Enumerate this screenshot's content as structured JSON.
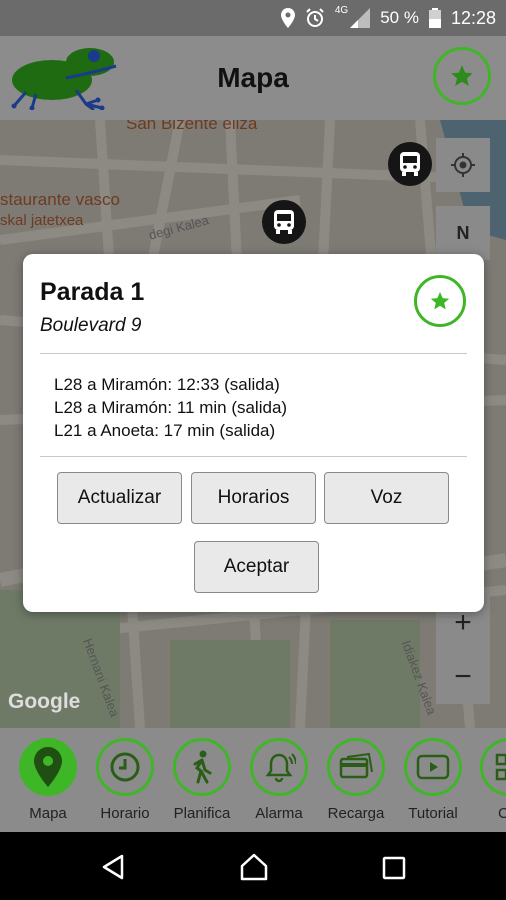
{
  "status_bar": {
    "network": "4G",
    "battery": "50 %",
    "time": "12:28",
    "icons": [
      "location-icon",
      "alarm-clock-icon",
      "signal-icon",
      "battery-icon"
    ]
  },
  "header": {
    "title": "Mapa",
    "logo_icon": "frog-logo-icon",
    "favorite_icon": "star-icon"
  },
  "map": {
    "labels": {
      "church": "San Bizente eliza",
      "restaurant_line1": "staurante vasco",
      "restaurant_line2": "skal jatetxea",
      "street_a": "degi Kalea",
      "street_b": "Hernani Kalea",
      "street_c": "Idiakez Kalea"
    },
    "google": "Google",
    "controls": {
      "compass": "N",
      "zoom_in": "+",
      "zoom_out": "−"
    }
  },
  "dialog": {
    "title": "Parada 1",
    "subtitle": "Boulevard 9",
    "lines": [
      "L28 a Miramón: 12:33 (salida)",
      "L28 a Miramón: 11 min (salida)",
      "L21 a Anoeta: 17 min (salida)"
    ],
    "buttons": {
      "update": "Actualizar",
      "schedules": "Horarios",
      "voice": "Voz",
      "accept": "Aceptar"
    }
  },
  "bottom_nav": {
    "items": [
      {
        "label": "Mapa",
        "icon": "map-pin-icon",
        "active": true
      },
      {
        "label": "Horario",
        "icon": "clock-icon",
        "active": false
      },
      {
        "label": "Planifica",
        "icon": "walking-icon",
        "active": false
      },
      {
        "label": "Alarma",
        "icon": "bell-icon",
        "active": false
      },
      {
        "label": "Recarga",
        "icon": "card-icon",
        "active": false
      },
      {
        "label": "Tutorial",
        "icon": "play-icon",
        "active": false
      },
      {
        "label": "C",
        "icon": "qr-icon",
        "active": false
      }
    ]
  },
  "colors": {
    "accent_green": "#3fb628",
    "overlay_gray": "#7f7f7f"
  }
}
